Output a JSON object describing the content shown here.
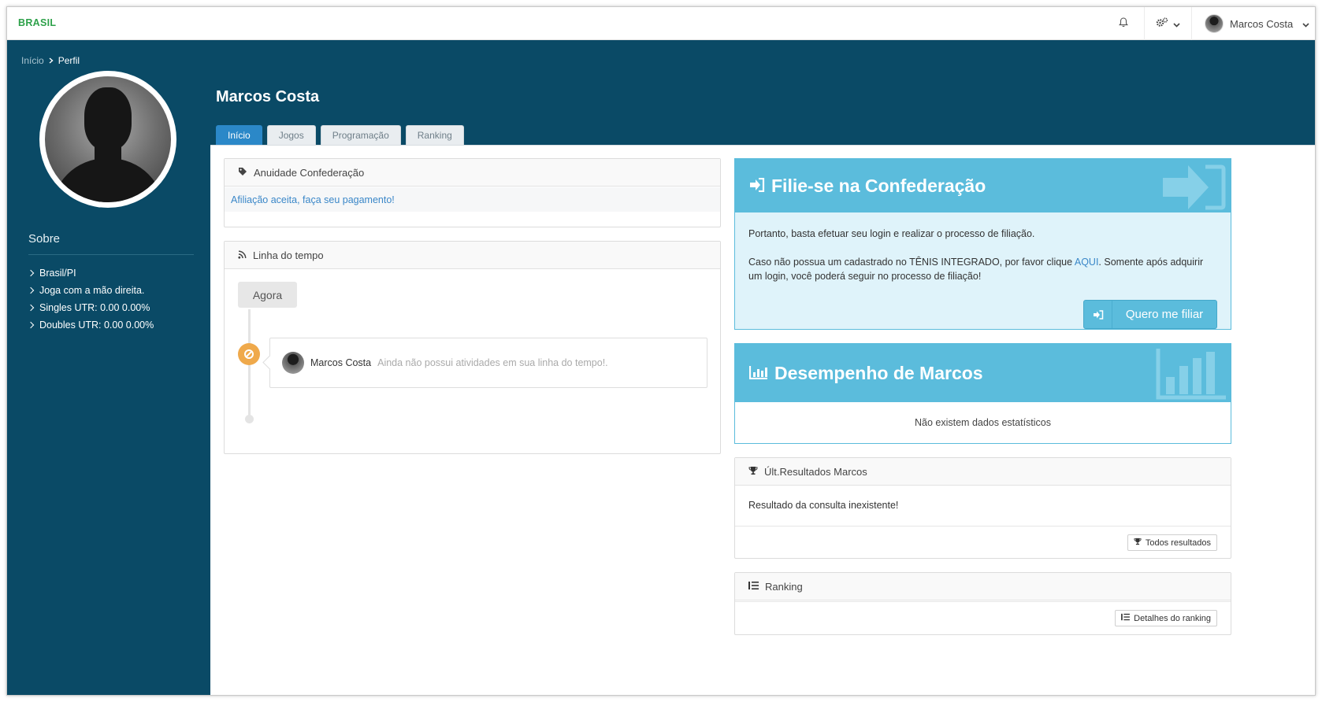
{
  "topbar": {
    "brand": "BRASIL",
    "user_name": "Marcos Costa"
  },
  "breadcrumb": {
    "home": "Início",
    "current": "Perfil"
  },
  "sidebar": {
    "about_title": "Sobre",
    "about_items": [
      "Brasil/PI",
      "Joga com a mão direita.",
      "Singles UTR: 0.00 0.00%",
      "Doubles UTR: 0.00 0.00%"
    ]
  },
  "profile": {
    "name": "Marcos Costa",
    "tabs": [
      "Início",
      "Jogos",
      "Programação",
      "Ranking"
    ],
    "active_tab": "Início"
  },
  "anuidade": {
    "title": "Anuidade Confederação",
    "message": "Afiliação aceita, faça seu pagamento!"
  },
  "timeline": {
    "title": "Linha do tempo",
    "now_label": "Agora",
    "entry_user": "Marcos Costa",
    "entry_text": "Ainda não possui atividades em sua linha do tempo!."
  },
  "filie": {
    "title": "Filie-se na Confederação",
    "text1": "Portanto, basta efetuar seu login e realizar o processo de filiação.",
    "text2_before": "Caso não possua um cadastrado no TÊNIS INTEGRADO, por favor clique ",
    "text2_link": "AQUI",
    "text2_after": ". Somente após adquirir um login, você poderá seguir no processo de filiação!",
    "button": "Quero me filiar"
  },
  "desempenho": {
    "title": "Desempenho de Marcos",
    "empty": "Não existem dados estatísticos"
  },
  "resultados": {
    "title": "Últ.Resultados Marcos",
    "message": "Resultado da consulta inexistente!",
    "button": "Todos resultados"
  },
  "ranking": {
    "title": "Ranking",
    "button": "Detalhes do ranking"
  },
  "colors": {
    "sidebar_bg": "#0a4a66",
    "brand_green": "#2ea14a",
    "accent_blue": "#2b88c8",
    "hero_blue": "#5bbcdc",
    "timeline_dot": "#efa94b"
  }
}
